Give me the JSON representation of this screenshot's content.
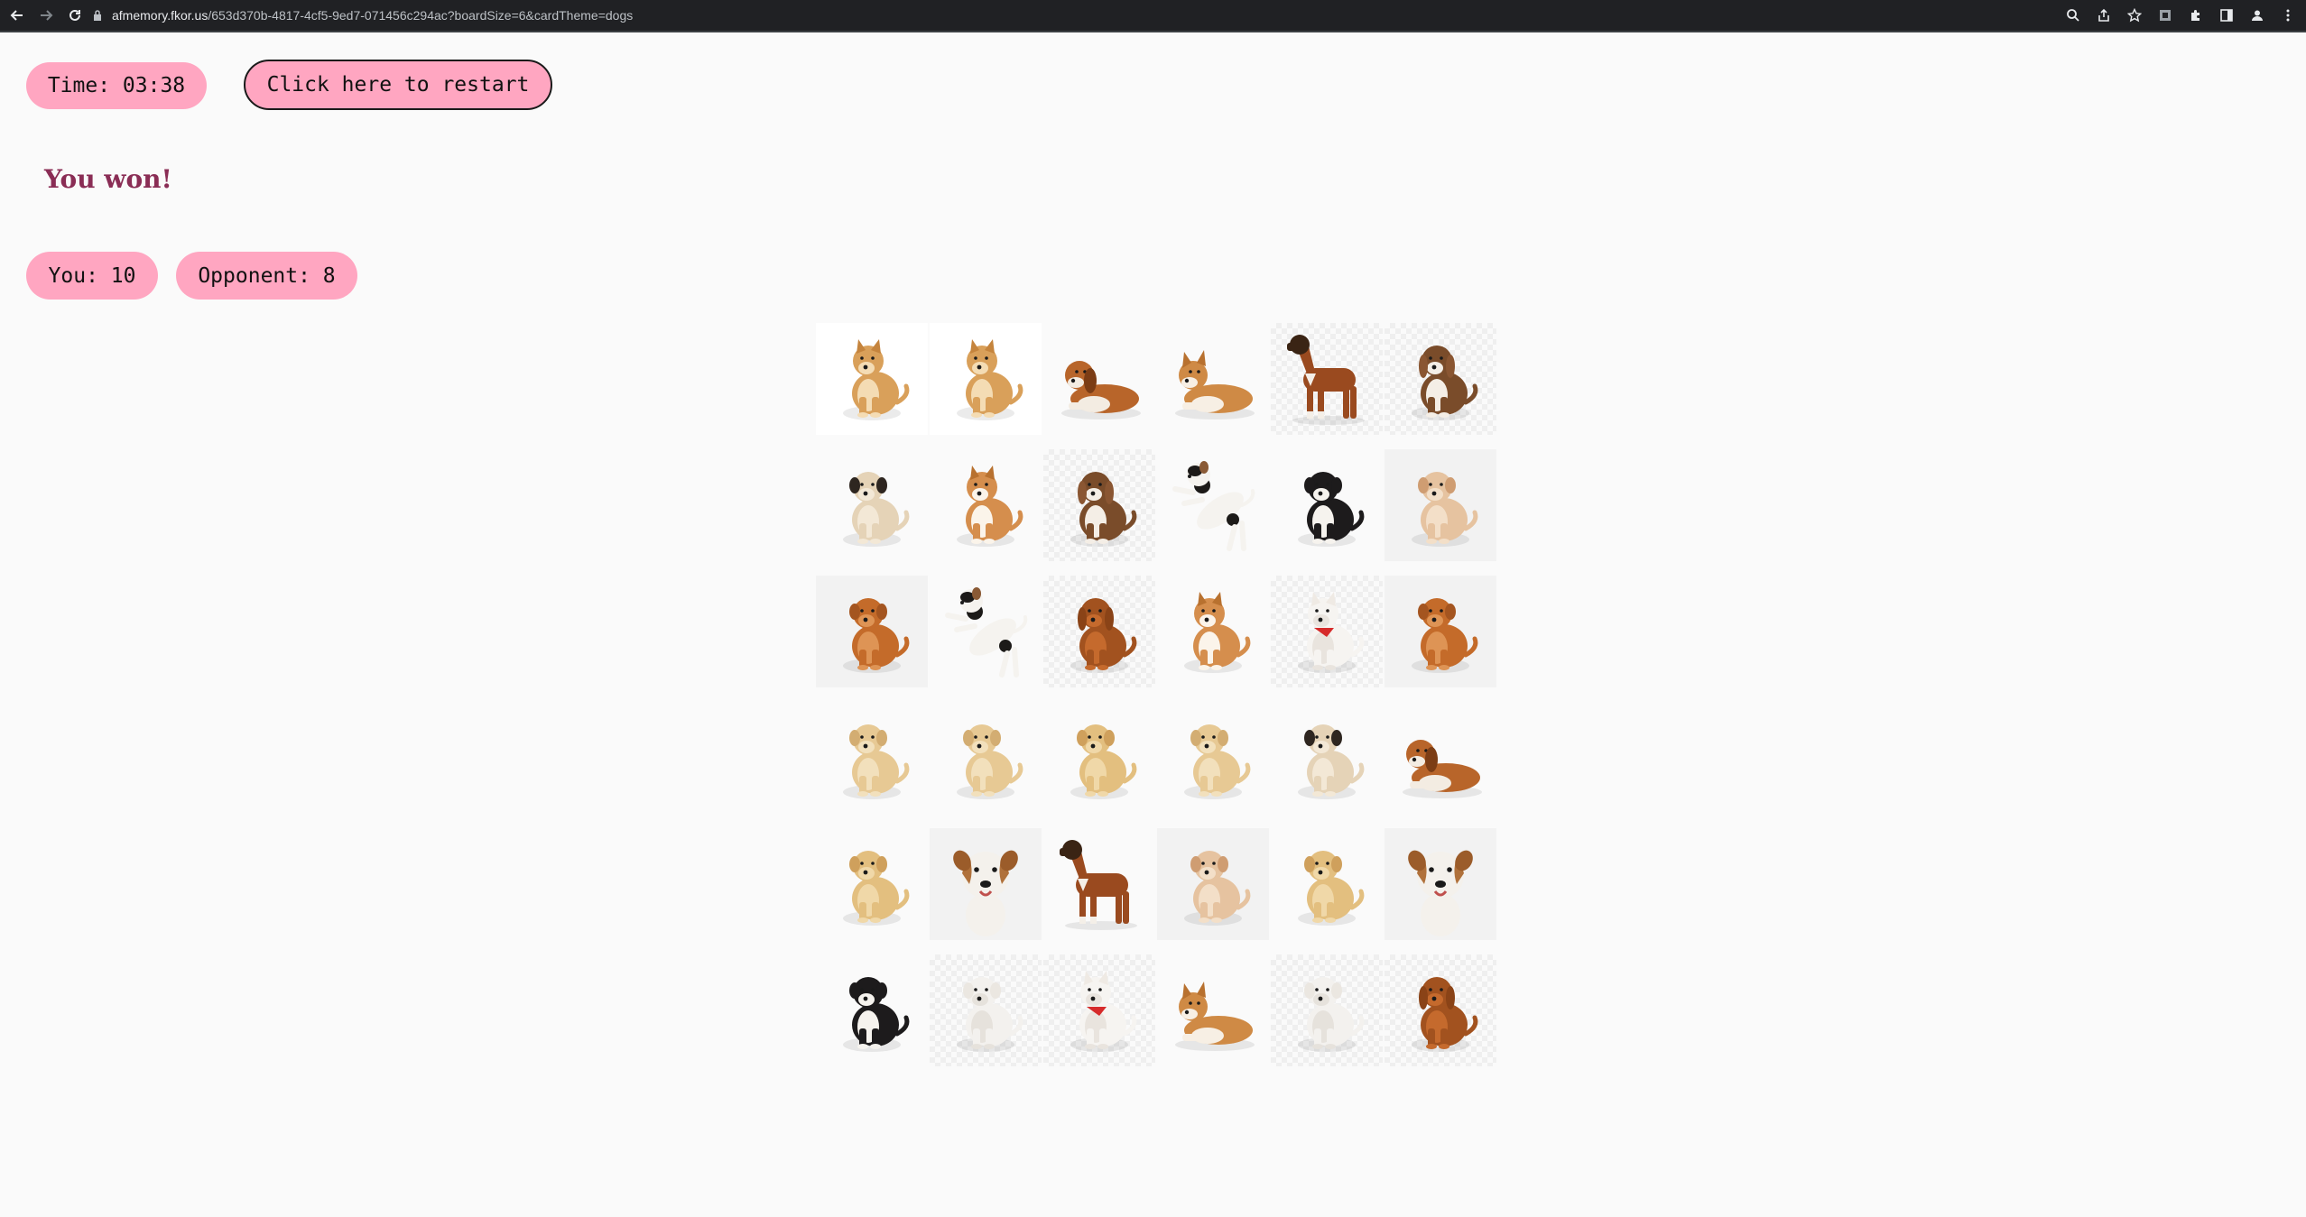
{
  "browser": {
    "url_domain": "afmemory.fkor.us",
    "url_path": "/653d370b-4817-4cf5-9ed7-071456c294ac?boardSize=6&cardTheme=dogs",
    "icons": [
      "back-icon",
      "forward-icon",
      "reload-icon",
      "lock-icon",
      "zoom-icon",
      "share-icon",
      "star-icon",
      "extension-icon",
      "puzzle-icon",
      "sidepanel-icon",
      "profile-icon",
      "menu-icon"
    ]
  },
  "game": {
    "timer_label": "Time: 03:38",
    "restart_label": "Click here to restart",
    "result_text": "You won!",
    "score_you": "You: 10",
    "score_opponent": "Opponent: 8",
    "colors": {
      "pill": "#ffa6c1",
      "result": "#8a2d55",
      "background": "#fafafa"
    }
  },
  "board": {
    "size": 6,
    "theme": "dogs",
    "cards": [
      {
        "breed": "shiba",
        "bg": "white"
      },
      {
        "breed": "shiba",
        "bg": "white"
      },
      {
        "breed": "basset",
        "bg": "none"
      },
      {
        "breed": "corgi",
        "bg": "none"
      },
      {
        "breed": "boxer",
        "bg": "check"
      },
      {
        "breed": "beagle",
        "bg": "check"
      },
      {
        "breed": "pug",
        "bg": "none"
      },
      {
        "breed": "corgi-front",
        "bg": "none"
      },
      {
        "breed": "beagle",
        "bg": "check"
      },
      {
        "breed": "jack-russell",
        "bg": "none"
      },
      {
        "breed": "bernese",
        "bg": "none"
      },
      {
        "breed": "maltipoo",
        "bg": "grey"
      },
      {
        "breed": "golden",
        "bg": "grey"
      },
      {
        "breed": "jack-russell",
        "bg": "none"
      },
      {
        "breed": "spaniel",
        "bg": "check"
      },
      {
        "breed": "corgi-front",
        "bg": "none"
      },
      {
        "breed": "samoyed",
        "bg": "check"
      },
      {
        "breed": "golden",
        "bg": "grey"
      },
      {
        "breed": "puppy-cream",
        "bg": "none"
      },
      {
        "breed": "puppy-cream",
        "bg": "none"
      },
      {
        "breed": "lab-puppy",
        "bg": "none"
      },
      {
        "breed": "puppy-cream",
        "bg": "none"
      },
      {
        "breed": "pug",
        "bg": "none"
      },
      {
        "breed": "basset",
        "bg": "none"
      },
      {
        "breed": "lab-puppy",
        "bg": "none"
      },
      {
        "breed": "terrier-head",
        "bg": "grey"
      },
      {
        "breed": "boxer",
        "bg": "none"
      },
      {
        "breed": "maltipoo",
        "bg": "grey"
      },
      {
        "breed": "lab-puppy",
        "bg": "none"
      },
      {
        "breed": "terrier-head",
        "bg": "grey"
      },
      {
        "breed": "bernese",
        "bg": "none"
      },
      {
        "breed": "poodle-white",
        "bg": "check"
      },
      {
        "breed": "samoyed",
        "bg": "check"
      },
      {
        "breed": "corgi",
        "bg": "none"
      },
      {
        "breed": "poodle-white",
        "bg": "check"
      },
      {
        "breed": "spaniel",
        "bg": "check"
      }
    ]
  }
}
